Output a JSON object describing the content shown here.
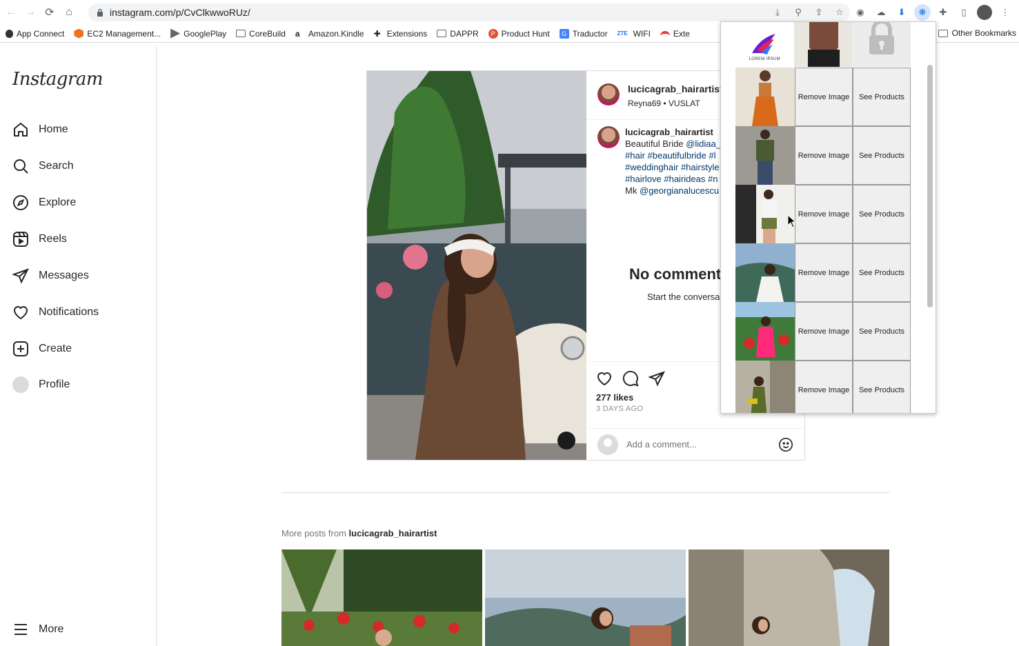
{
  "browser": {
    "url": "instagram.com/p/CvClkwwoRUz/",
    "bookmarks": [
      "App Connect",
      "EC2 Management...",
      "GooglePlay",
      "CoreBuild",
      "Amazon.Kindle",
      "Extensions",
      "DAPPR",
      "Product Hunt",
      "Traductor",
      "WIFI",
      "Exte"
    ],
    "other_bookmarks": "Other Bookmarks"
  },
  "instagram": {
    "logo": "Instagram",
    "nav": [
      "Home",
      "Search",
      "Explore",
      "Reels",
      "Messages",
      "Notifications",
      "Create",
      "Profile"
    ],
    "more": "More"
  },
  "post": {
    "author": "lucicagrab_hairartist",
    "audio": "Reyna69 • VUSLAT",
    "caption_author": "lucicagrab_hairartist",
    "caption_lines": [
      "Beautiful Bride",
      "#hair #beautifulbride #l",
      "#weddinghair #hairstyle",
      "#hairlove #hairideas #n",
      "Mk"
    ],
    "mention_bride": "@lidiaa_",
    "mention_mk": "@georgianalucescu",
    "no_comments": "No comments",
    "start_conversation": "Start the conversa",
    "likes": "277 likes",
    "ago": "3 DAYS AGO",
    "add_comment_placeholder": "Add a comment..."
  },
  "more_posts": {
    "prefix": "More posts from ",
    "user": "lucicagrab_hairartist"
  },
  "popup": {
    "logo_text": "LOREM IPSUM",
    "remove_label": "Remove Image",
    "see_products_label": "See Products"
  }
}
